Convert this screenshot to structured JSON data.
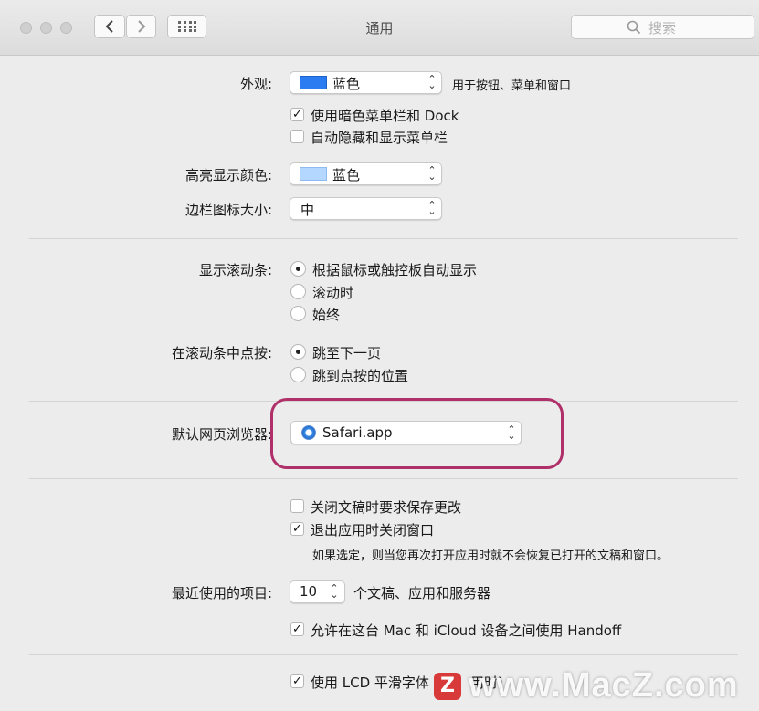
{
  "window": {
    "title": "通用",
    "search_placeholder": "搜索"
  },
  "appearance": {
    "label": "外观:",
    "value": "蓝色",
    "note": "用于按钮、菜单和窗口",
    "swatch_color": "#2b7bf1"
  },
  "dark_menu": {
    "label": "使用暗色菜单栏和 Dock",
    "checked": true
  },
  "auto_hide": {
    "label": "自动隐藏和显示菜单栏",
    "checked": false
  },
  "highlight": {
    "label": "高亮显示颜色:",
    "value": "蓝色",
    "swatch_color": "#b3d7ff"
  },
  "sidebar_icon": {
    "label": "边栏图标大小:",
    "value": "中"
  },
  "scrollbars": {
    "label": "显示滚动条:",
    "options": [
      "根据鼠标或触控板自动显示",
      "滚动时",
      "始终"
    ],
    "selected": 0
  },
  "click_scroll": {
    "label": "在滚动条中点按:",
    "options": [
      "跳至下一页",
      "跳到点按的位置"
    ],
    "selected": 0
  },
  "browser": {
    "label": "默认网页浏览器:",
    "value": "Safari.app"
  },
  "close_docs": {
    "label": "关闭文稿时要求保存更改",
    "checked": false
  },
  "close_windows": {
    "label": "退出应用时关闭窗口",
    "checked": true,
    "note": "如果选定，则当您再次打开应用时就不会恢复已打开的文稿和窗口。"
  },
  "recent": {
    "label": "最近使用的项目:",
    "value": "10",
    "suffix": "个文稿、应用和服务器"
  },
  "handoff": {
    "label": "允许在这台 Mac 和 iCloud 设备之间使用 Handoff",
    "checked": true
  },
  "lcd": {
    "label": "使用 LCD 平滑字体",
    "tail": "用时)",
    "checked": true
  },
  "watermark": {
    "text": "www.MacZ.com",
    "logo": "Z"
  }
}
